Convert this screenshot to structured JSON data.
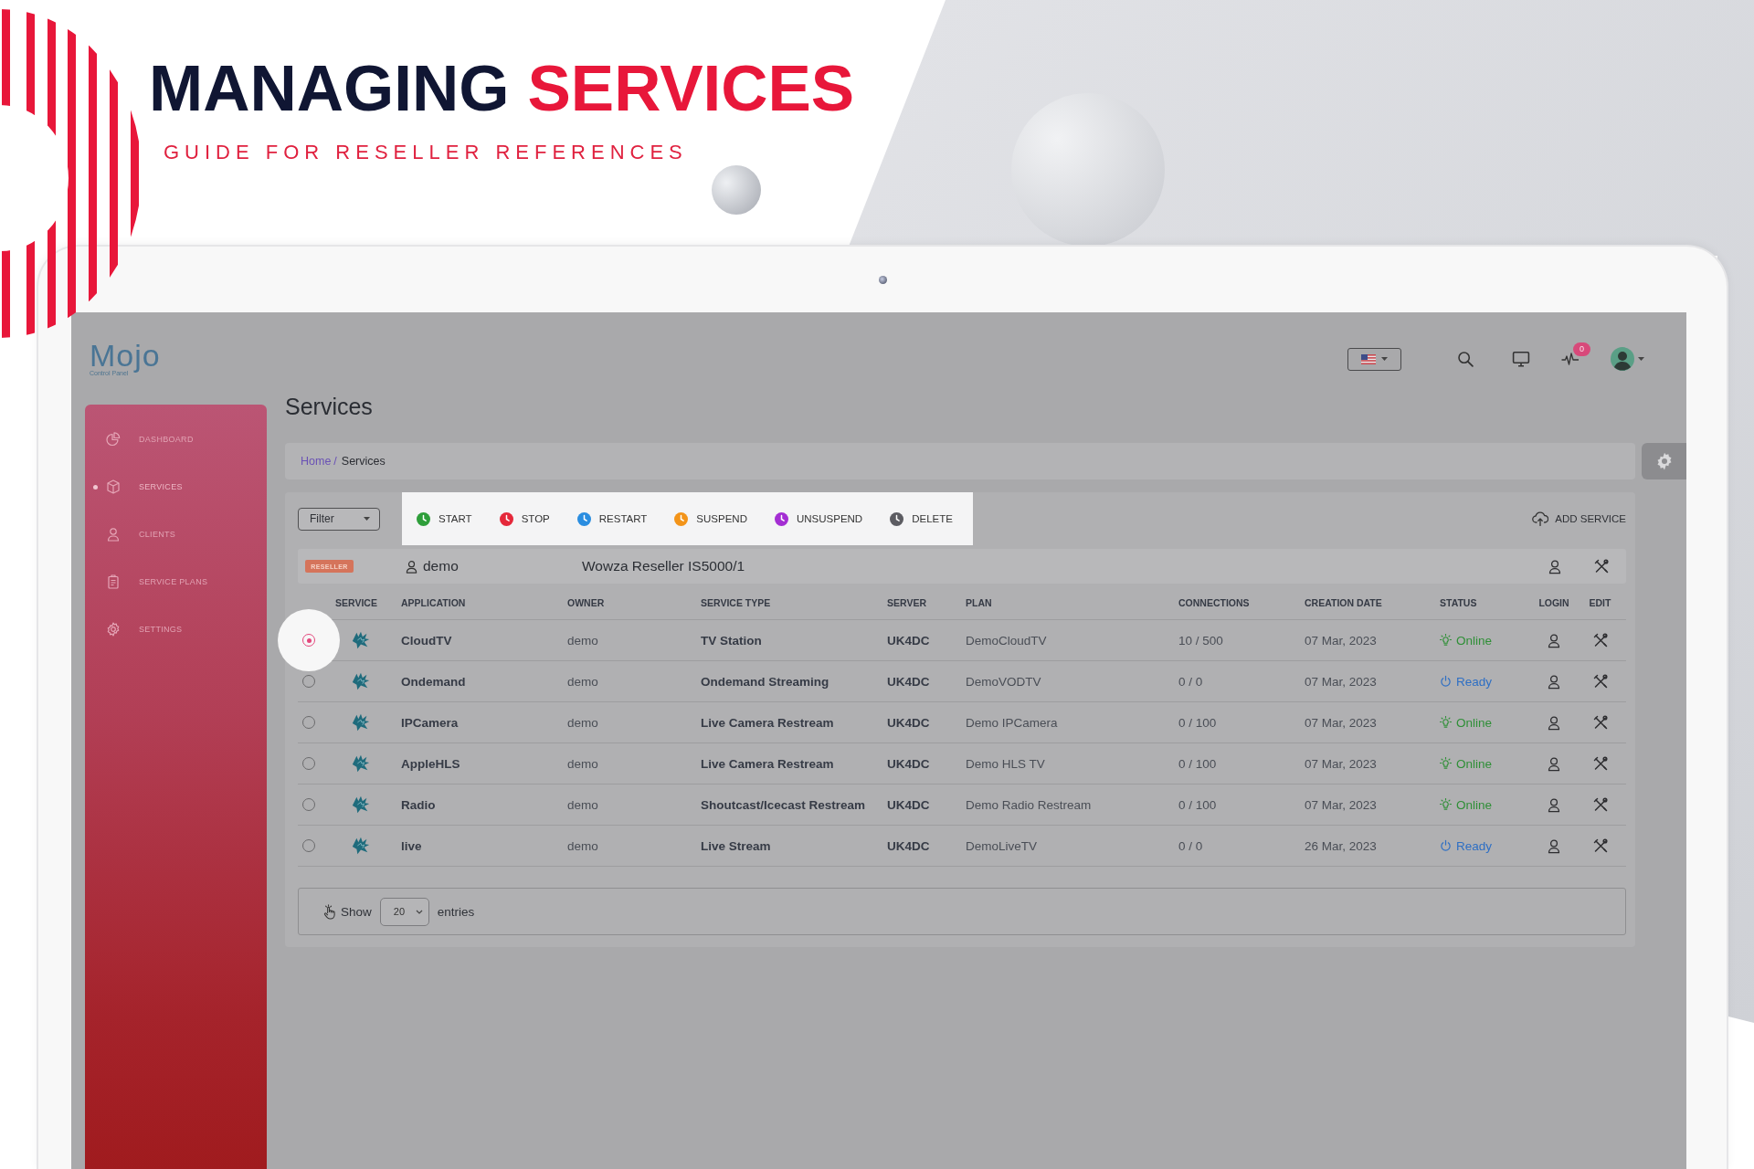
{
  "banner": {
    "title": [
      {
        "text": "MANAGING",
        "accent": false
      },
      {
        "text": "SERVICES",
        "accent": true
      }
    ],
    "subtitle": "GUIDE FOR RESELLER REFERENCES"
  },
  "logo": {
    "name": "Mojo",
    "tagline": "Control Panel"
  },
  "topbar": {
    "notification_count": "0"
  },
  "sidebar": {
    "items": [
      {
        "label": "DASHBOARD",
        "kind": "dashboard",
        "selected": false
      },
      {
        "label": "SERVICES",
        "kind": "services",
        "selected": true
      },
      {
        "label": "CLIENTS",
        "kind": "clients",
        "selected": false
      },
      {
        "label": "SERVICE PLANS",
        "kind": "plans",
        "selected": false
      },
      {
        "label": "SETTINGS",
        "kind": "settings",
        "selected": false
      }
    ]
  },
  "page_title": "Services",
  "breadcrumb": {
    "items": [
      {
        "label": "Home",
        "current": false
      },
      {
        "label": "Services",
        "current": true
      }
    ],
    "separator": "/"
  },
  "toolbar": {
    "filter": "Filter",
    "actions": [
      {
        "label": "START",
        "color": "#2e9e3a"
      },
      {
        "label": "STOP",
        "color": "#e5283a"
      },
      {
        "label": "RESTART",
        "color": "#2a8de0"
      },
      {
        "label": "SUSPEND",
        "color": "#f39419"
      },
      {
        "label": "UNSUSPEND",
        "color": "#a42ed3"
      },
      {
        "label": "DELETE",
        "color": "#5c5c62"
      }
    ],
    "add_button": "ADD SERVICE"
  },
  "reseller": {
    "badge": "RESELLER",
    "user": "demo",
    "title": "Wowza Reseller IS5000/1"
  },
  "table": {
    "columns": [
      "SERVICE",
      "APPLICATION",
      "OWNER",
      "SERVICE TYPE",
      "SERVER",
      "PLAN",
      "CONNECTIONS",
      "CREATION DATE",
      "STATUS",
      "LOGIN",
      "EDIT"
    ],
    "rows": [
      {
        "selected": true,
        "application": "CloudTV",
        "owner": "demo",
        "service_type": "TV Station",
        "server": "UK4DC",
        "plan": "DemoCloudTV",
        "connections": "10 / 500",
        "created": "07 Mar, 2023",
        "status": {
          "label": "Online",
          "kind": "online"
        }
      },
      {
        "selected": false,
        "application": "Ondemand",
        "owner": "demo",
        "service_type": "Ondemand Streaming",
        "server": "UK4DC",
        "plan": "DemoVODTV",
        "connections": "0 / 0",
        "created": "07 Mar, 2023",
        "status": {
          "label": "Ready",
          "kind": "ready"
        }
      },
      {
        "selected": false,
        "application": "IPCamera",
        "owner": "demo",
        "service_type": "Live Camera Restream",
        "server": "UK4DC",
        "plan": "Demo IPCamera",
        "connections": "0 / 100",
        "created": "07 Mar, 2023",
        "status": {
          "label": "Online",
          "kind": "online"
        }
      },
      {
        "selected": false,
        "application": "AppleHLS",
        "owner": "demo",
        "service_type": "Live Camera Restream",
        "server": "UK4DC",
        "plan": "Demo HLS TV",
        "connections": "0 / 100",
        "created": "07 Mar, 2023",
        "status": {
          "label": "Online",
          "kind": "online"
        }
      },
      {
        "selected": false,
        "application": "Radio",
        "owner": "demo",
        "service_type": "Shoutcast/Icecast Restream",
        "server": "UK4DC",
        "plan": "Demo Radio Restream",
        "connections": "0 / 100",
        "created": "07 Mar, 2023",
        "status": {
          "label": "Online",
          "kind": "online"
        }
      },
      {
        "selected": false,
        "application": "live",
        "owner": "demo",
        "service_type": "Live Stream",
        "server": "UK4DC",
        "plan": "DemoLiveTV",
        "connections": "0 / 0",
        "created": "26 Mar, 2023",
        "status": {
          "label": "Ready",
          "kind": "ready"
        }
      }
    ]
  },
  "pagination": {
    "label_before": "Show",
    "page_size": "20",
    "label_after": "entries"
  }
}
